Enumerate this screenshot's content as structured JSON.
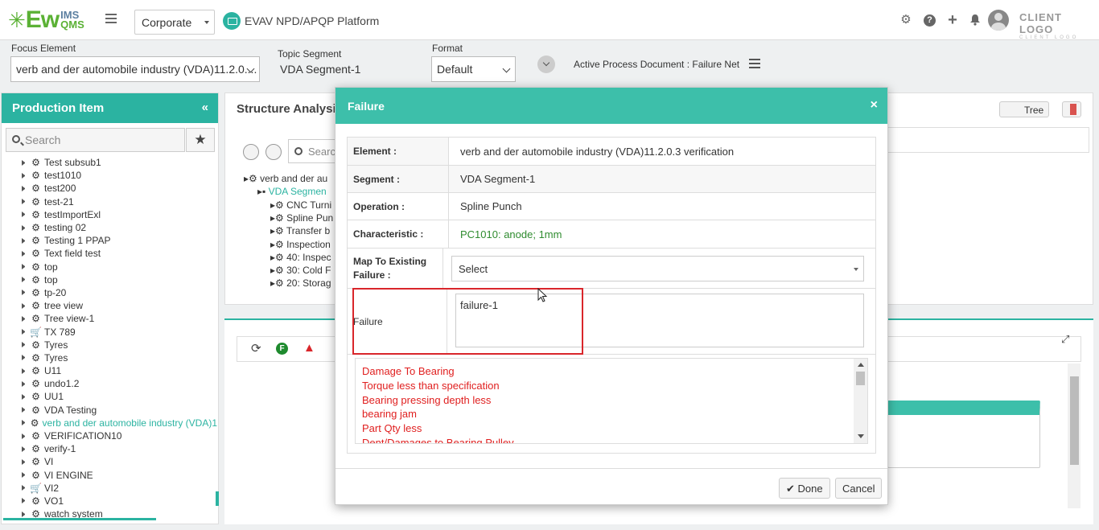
{
  "header": {
    "logo_main": "Ew",
    "logo_sup": "IMS",
    "logo_sub": "QMS",
    "org_select": "Corporate",
    "platform": "EVAV NPD/APQP Platform",
    "client_logo": "CLIENT LOGO",
    "client_logo_sub": "CLIENT LOGO",
    "icons": [
      "gear-icon",
      "help-icon",
      "plus-icon",
      "bell-icon"
    ]
  },
  "filters": {
    "focus_label": "Focus Element",
    "focus_value": "verb and der automobile industry (VDA)11.2.0....",
    "topic_label": "Topic Segment",
    "topic_value": "VDA Segment-1",
    "format_label": "Format",
    "format_value": "Default",
    "active_doc": "Active Process Document : Failure Net"
  },
  "left_panel": {
    "title": "Production Item",
    "search_placeholder": "Search",
    "items": [
      {
        "label": "Test subsub1",
        "icon": "gears"
      },
      {
        "label": "test1010",
        "icon": "gears"
      },
      {
        "label": "test200",
        "icon": "gears"
      },
      {
        "label": "test-21",
        "icon": "gears"
      },
      {
        "label": "testImportExl",
        "icon": "gears"
      },
      {
        "label": "testing 02",
        "icon": "gears"
      },
      {
        "label": "Testing 1 PPAP",
        "icon": "gears"
      },
      {
        "label": "Text field test",
        "icon": "gears"
      },
      {
        "label": "top",
        "icon": "gears"
      },
      {
        "label": "top",
        "icon": "gears"
      },
      {
        "label": "tp-20",
        "icon": "gears"
      },
      {
        "label": "tree view",
        "icon": "gears"
      },
      {
        "label": "Tree view-1",
        "icon": "gears"
      },
      {
        "label": "TX 789",
        "icon": "cart"
      },
      {
        "label": "Tyres",
        "icon": "gears"
      },
      {
        "label": "Tyres",
        "icon": "gears"
      },
      {
        "label": "U11",
        "icon": "gears"
      },
      {
        "label": "undo1.2",
        "icon": "gears"
      },
      {
        "label": "UU1",
        "icon": "gears"
      },
      {
        "label": "VDA Testing",
        "icon": "gears"
      },
      {
        "label": "verb and der automobile industry (VDA)1",
        "icon": "gears",
        "active": true
      },
      {
        "label": "VERIFICATION10",
        "icon": "gears"
      },
      {
        "label": "verify-1",
        "icon": "gears"
      },
      {
        "label": "VI",
        "icon": "gears"
      },
      {
        "label": "VI ENGINE",
        "icon": "gears"
      },
      {
        "label": "VI2",
        "icon": "cart"
      },
      {
        "label": "VO1",
        "icon": "gears"
      },
      {
        "label": "watch system",
        "icon": "gears"
      }
    ]
  },
  "structure": {
    "title": "Structure Analysis",
    "toggle_label": "Tree",
    "search_placeholder": "Search",
    "tree": [
      {
        "label": "verb and der au",
        "level": 0
      },
      {
        "label": "VDA Segmen",
        "level": 1,
        "active": true
      },
      {
        "label": "CNC Turni",
        "level": 2
      },
      {
        "label": "Spline Pun",
        "level": 2
      },
      {
        "label": "Transfer b",
        "level": 2
      },
      {
        "label": "Inspection",
        "level": 2
      },
      {
        "label": "40: Inspec",
        "level": 2
      },
      {
        "label": "30: Cold F",
        "level": 2
      },
      {
        "label": "20: Storag",
        "level": 2
      }
    ]
  },
  "modal": {
    "title": "Failure",
    "close": "×",
    "rows": {
      "element_label": "Element :",
      "element_value": "verb and der automobile industry (VDA)11.2.0.3 verification",
      "segment_label": "Segment :",
      "segment_value": "VDA Segment-1",
      "operation_label": "Operation :",
      "operation_value": "Spline Punch",
      "characteristic_label": "Characteristic :",
      "characteristic_value": "PC1010: anode; 1mm",
      "map_label": "Map To Existing Failure :",
      "map_value": "Select",
      "failure_label": "Failure",
      "failure_value": "failure-1"
    },
    "failure_list": [
      "Damage To Bearing",
      "Torque less than specification",
      "Bearing pressing depth less",
      "bearing jam",
      "Part Qty less",
      "Dent/Damages to Bearing Pulley"
    ],
    "done_label": "Done",
    "cancel_label": "Cancel"
  }
}
